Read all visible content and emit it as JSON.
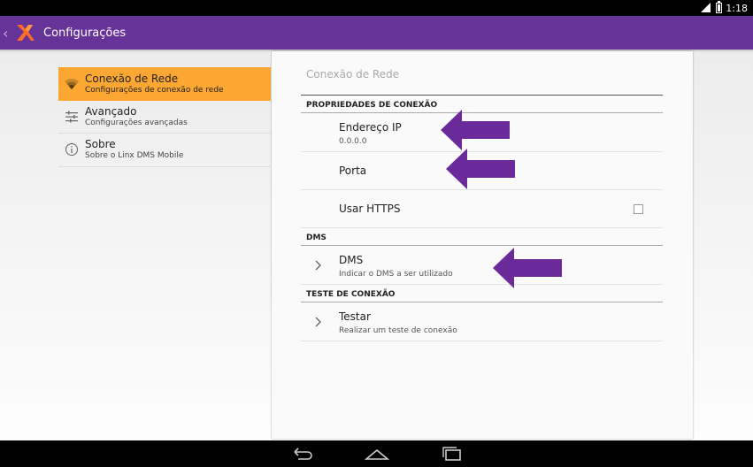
{
  "status_bar": {
    "time": "1:18"
  },
  "action_bar": {
    "title": "Configurações"
  },
  "sidebar": {
    "items": [
      {
        "title": "Conexão de Rede",
        "subtitle": "Configurações de conexão de rede"
      },
      {
        "title": "Avançado",
        "subtitle": "Configurações avançadas"
      },
      {
        "title": "Sobre",
        "subtitle": "Sobre o Linx DMS Mobile"
      }
    ]
  },
  "panel": {
    "title": "Conexão de Rede",
    "sections": [
      {
        "header": "PROPRIEDADES DE CONEXÃO"
      },
      {
        "header": "DMS"
      },
      {
        "header": "TESTE DE CONEXÃO"
      }
    ],
    "prefs": {
      "ip": {
        "title": "Endereço IP",
        "value": "0.0.0.0"
      },
      "port": {
        "title": "Porta"
      },
      "https": {
        "title": "Usar HTTPS",
        "checked": false
      },
      "dms": {
        "title": "DMS",
        "subtitle": "Indicar o DMS a ser utilizado"
      },
      "test": {
        "title": "Testar",
        "subtitle": "Realizar um teste de conexão"
      }
    }
  },
  "colors": {
    "accent": "#663399",
    "active_item": "#fba732",
    "arrow": "#6a2a9a"
  }
}
